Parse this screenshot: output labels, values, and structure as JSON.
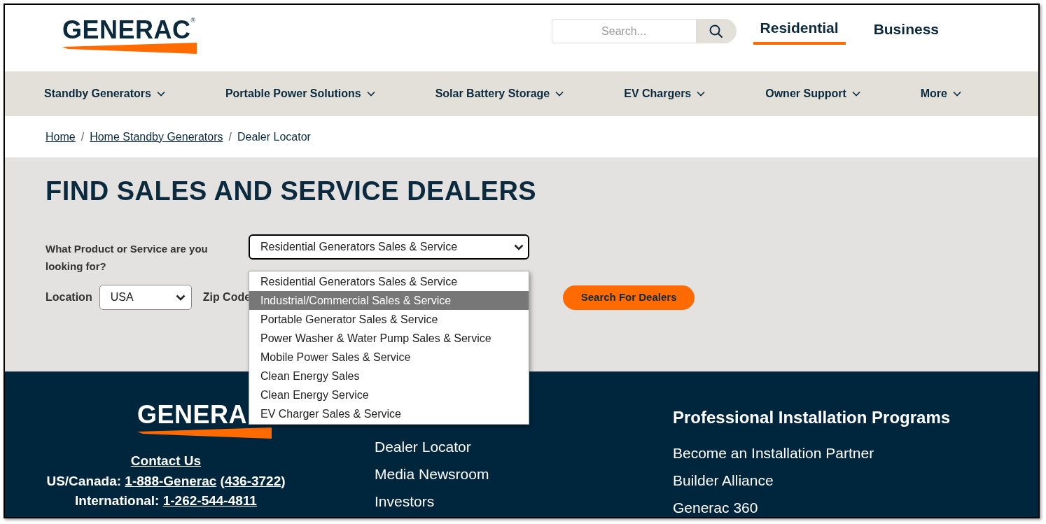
{
  "header": {
    "logo": "GENERAC",
    "logo_mark": "®",
    "search": {
      "placeholder": "Search..."
    },
    "audience_tabs": [
      {
        "label": "Residential",
        "selected": true
      },
      {
        "label": "Business",
        "selected": false
      }
    ]
  },
  "nav": [
    "Standby Generators",
    "Portable Power Solutions",
    "Solar Battery Storage",
    "EV Chargers",
    "Owner Support",
    "More"
  ],
  "breadcrumb_separator": "/",
  "breadcrumb": [
    {
      "label": "Home",
      "link": true
    },
    {
      "label": "Home Standby Generators",
      "link": true
    },
    {
      "label": "Dealer Locator",
      "link": false
    }
  ],
  "title": "FIND SALES AND SERVICE DEALERS",
  "form": {
    "product_label": "What Product or Service are you looking for?",
    "product_value": "Residential Generators Sales & Service",
    "product_options": [
      {
        "label": "Residential Generators Sales & Service",
        "selected": false
      },
      {
        "label": "Industrial/Commercial Sales & Service",
        "selected": true
      },
      {
        "label": "Portable Generator Sales & Service",
        "selected": false
      },
      {
        "label": "Power Washer & Water Pump Sales & Service",
        "selected": false
      },
      {
        "label": "Mobile Power Sales & Service",
        "selected": false
      },
      {
        "label": "Clean Energy Sales",
        "selected": false
      },
      {
        "label": "Clean Energy Service",
        "selected": false
      },
      {
        "label": "EV Charger Sales & Service",
        "selected": false
      }
    ],
    "location_label": "Location",
    "location_value": "USA",
    "zip_label": "Zip Code",
    "submit": "Search For Dealers"
  },
  "footer": {
    "logo": "GENERA",
    "contact_heading": "Contact Us",
    "contact_lines": [
      [
        {
          "text": "US/Canada:",
          "link": false
        },
        {
          "text": "1-888-Generac",
          "link": true
        },
        {
          "text": "436-3722",
          "link": true,
          "before": "(",
          "after": ")"
        }
      ],
      [
        {
          "text": "International:",
          "link": false
        },
        {
          "text": "1-262-544-4811",
          "link": true
        }
      ]
    ],
    "links": [
      "Dealer Locator",
      "Media Newsroom",
      "Investors"
    ],
    "programs_heading": "Professional Installation Programs",
    "programs": [
      "Become an Installation Partner",
      "Builder Alliance",
      "Generac 360"
    ]
  }
}
